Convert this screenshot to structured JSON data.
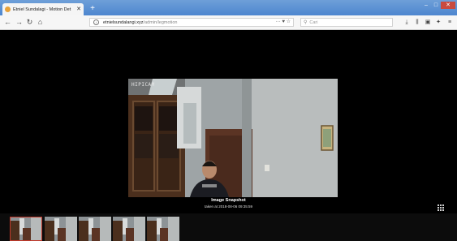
{
  "browser": {
    "tab_title": "Etniel Sundalagi - Motion Det",
    "tab_close": "✕",
    "new_tab": "+",
    "url_host": "etnielsundalangi.xyz",
    "url_path": "/admin/legmotion",
    "search_placeholder": "Cari",
    "page_actions": "··· ♥ ☆"
  },
  "viewer": {
    "camera_label": "HIPICAM",
    "title": "Image Snapshot",
    "subtitle": "taken at 2018-08-06 09:35:59"
  },
  "thumbnails": [
    {
      "name": "thumb-1",
      "active": true
    },
    {
      "name": "thumb-2",
      "active": false
    },
    {
      "name": "thumb-3",
      "active": false
    },
    {
      "name": "thumb-4",
      "active": false
    },
    {
      "name": "thumb-5",
      "active": false
    }
  ],
  "colors": {
    "active_border": "#c0392b",
    "titlebar": "#5b8fd4",
    "background": "#000000"
  }
}
